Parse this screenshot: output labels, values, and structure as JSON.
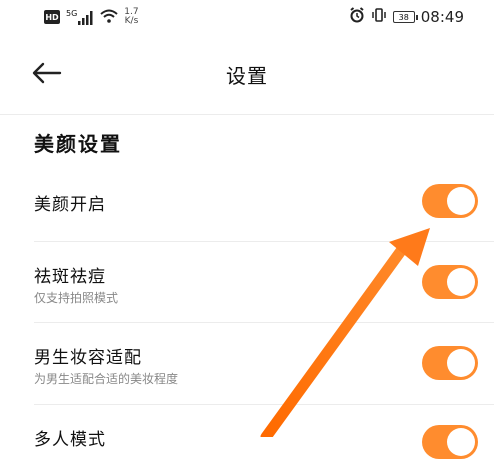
{
  "status_bar": {
    "hd": "HD",
    "signal": "5G",
    "net_speed_value": "1.7",
    "net_speed_unit": "K/s",
    "battery": "38",
    "time": "08:49"
  },
  "header": {
    "title": "设置"
  },
  "section": {
    "title": "美颜设置"
  },
  "settings": [
    {
      "title": "美颜开启",
      "subtitle": "",
      "enabled": true
    },
    {
      "title": "祛斑祛痘",
      "subtitle": "仅支持拍照模式",
      "enabled": true
    },
    {
      "title": "男生妆容适配",
      "subtitle": "为男生适配合适的美妆程度",
      "enabled": true
    },
    {
      "title": "多人模式",
      "subtitle": "",
      "enabled": true
    }
  ],
  "colors": {
    "accent": "#FF8C2E",
    "toggle_on": "#FF8C2E",
    "annotation_arrow": "#FF7A1A"
  }
}
